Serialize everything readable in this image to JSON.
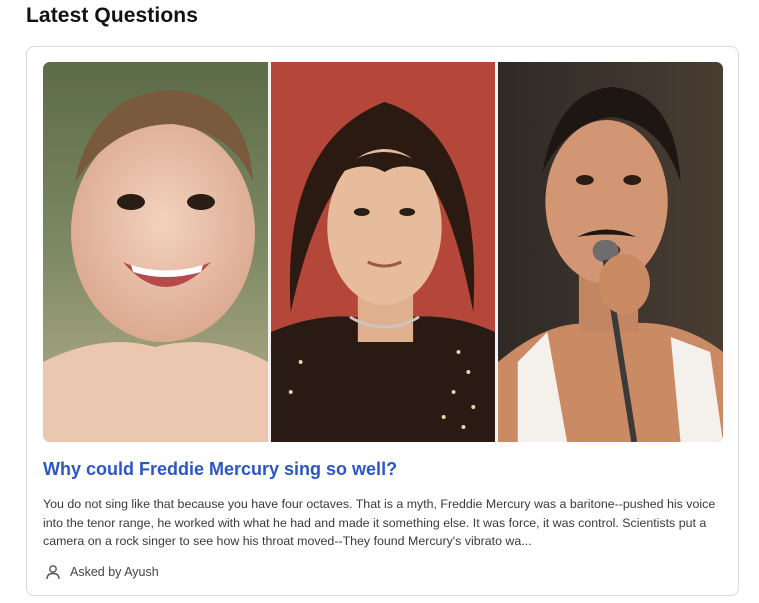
{
  "section": {
    "title": "Latest Questions"
  },
  "question": {
    "title": "Why could Freddie Mercury sing so well?",
    "excerpt": "You do not sing like that because you have four octaves. That is a myth, Freddie Mercury was a baritone--pushed his voice into the tenor range, he worked with what he had and made it something else. It was force, it was control. Scientists put a camera on a rock singer to see how his throat moved--They found Mercury's vibrato wa...",
    "asked_by": "Asked by Ayush",
    "images": [
      "baby-photo",
      "young-man-photo",
      "singer-with-microphone-photo"
    ]
  },
  "icons": {
    "author": "user-icon"
  },
  "colors": {
    "title_link": "#2a56c6",
    "card_border": "#d9d9d9"
  }
}
